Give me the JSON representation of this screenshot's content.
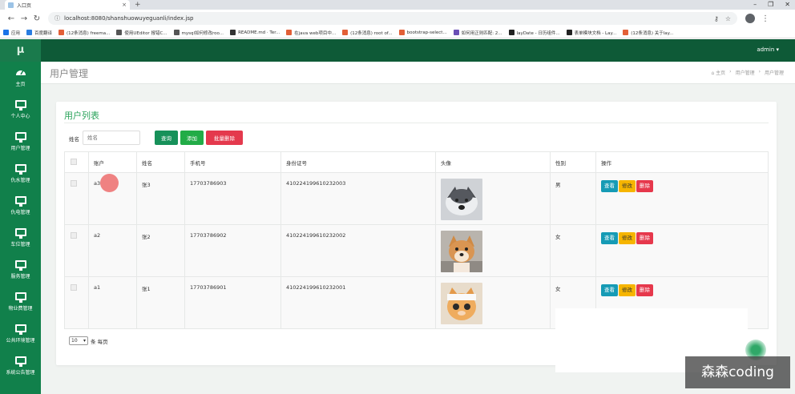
{
  "browser": {
    "tab_title": "入口页",
    "tab_close": "×",
    "new_tab": "+",
    "window_controls": [
      "–",
      "❐",
      "✕"
    ],
    "nav": {
      "back": "←",
      "forward": "→",
      "reload": "↻"
    },
    "url": "localhost:8080/shanshuowuyeguanli/index.jsp",
    "bookmarks": [
      {
        "label": "应用",
        "color": "#1a73e8"
      },
      {
        "label": "百度翻译",
        "color": "#2a7de1"
      },
      {
        "label": "(12条消息) freema...",
        "color": "#e25f37"
      },
      {
        "label": "使用UEditor 报错C...",
        "color": "#555555"
      },
      {
        "label": "mysql如何修改roo...",
        "color": "#555555"
      },
      {
        "label": "README.md · Ter...",
        "color": "#333333"
      },
      {
        "label": "在java web项目中...",
        "color": "#e25f37"
      },
      {
        "label": "(12条消息) root of...",
        "color": "#e25f37"
      },
      {
        "label": "bootstrap-select...",
        "color": "#e25f37"
      },
      {
        "label": "如何用正则匹配: 2...",
        "color": "#6a4fb5"
      },
      {
        "label": "layDate - 日历组件...",
        "color": "#222222"
      },
      {
        "label": "表单模块文档 - Lay...",
        "color": "#222222"
      },
      {
        "label": "(12条消息) 关于lay...",
        "color": "#e25f37"
      }
    ]
  },
  "app": {
    "logo": "μ",
    "user_menu": "admin ▾"
  },
  "sidebar": {
    "items": [
      {
        "label": "主页",
        "icon": "dashboard-icon"
      },
      {
        "label": "个人中心",
        "icon": "monitor-icon"
      },
      {
        "label": "用户管理",
        "icon": "monitor-icon"
      },
      {
        "label": "仇水管理",
        "icon": "monitor-icon"
      },
      {
        "label": "仇电管理",
        "icon": "monitor-icon"
      },
      {
        "label": "车位管理",
        "icon": "monitor-icon"
      },
      {
        "label": "服务管理",
        "icon": "monitor-icon"
      },
      {
        "label": "物业费管理",
        "icon": "monitor-icon"
      },
      {
        "label": "公共环境管理",
        "icon": "monitor-icon"
      },
      {
        "label": "系统公告管理",
        "icon": "monitor-icon"
      }
    ]
  },
  "page": {
    "title": "用户管理",
    "breadcrumb": [
      "⌂ 主页",
      "›",
      "用户管理",
      "›",
      "用户管理"
    ]
  },
  "list": {
    "title": "用户列表",
    "filter_label": "姓名",
    "filter_placeholder": "姓名",
    "btn_query": "查询",
    "btn_add": "添加",
    "btn_batch_delete": "批量删除",
    "columns": [
      "账户",
      "姓名",
      "手机号",
      "身份证号",
      "头像",
      "性别",
      "操作"
    ],
    "rows": [
      {
        "account": "a3",
        "name": "张3",
        "phone": "17703786903",
        "id_card": "410224199610232003",
        "gender": "男",
        "avatar": "husky-photo"
      },
      {
        "account": "a2",
        "name": "张2",
        "phone": "17703786902",
        "id_card": "410224199610232002",
        "gender": "女",
        "avatar": "shiba-photo"
      },
      {
        "account": "a1",
        "name": "张1",
        "phone": "17703786901",
        "id_card": "410224199610232001",
        "gender": "女",
        "avatar": "cat-photo"
      }
    ],
    "actions": {
      "view": "查看",
      "edit": "修改",
      "delete": "删除"
    },
    "pager": {
      "page_size": "10",
      "suffix": "条 每页"
    }
  },
  "watermark": "森森coding"
}
